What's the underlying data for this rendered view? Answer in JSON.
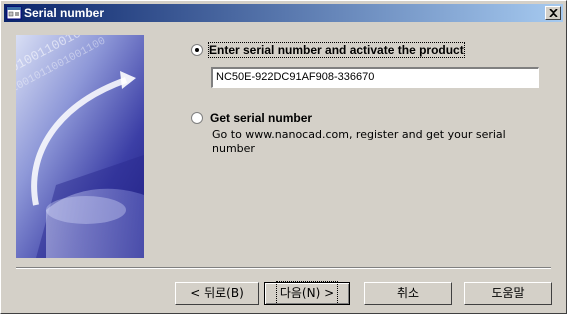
{
  "window": {
    "title": "Serial number"
  },
  "options": {
    "enter_label": "Enter serial number and activate the product",
    "serial_value": "NC50E-922DC91AF908-336670",
    "get_label": "Get serial number",
    "get_description": "Go to www.nanocad.com, register and get your serial number",
    "selected": "enter"
  },
  "buttons": {
    "back": "< 뒤로(B)",
    "next": "다음(N) >",
    "cancel": "취소",
    "help": "도움말"
  },
  "banner_binary_text": "0100110010010110",
  "colors": {
    "titlebar_start": "#0a246a",
    "titlebar_end": "#a6caf0",
    "face": "#d4d0c8"
  }
}
